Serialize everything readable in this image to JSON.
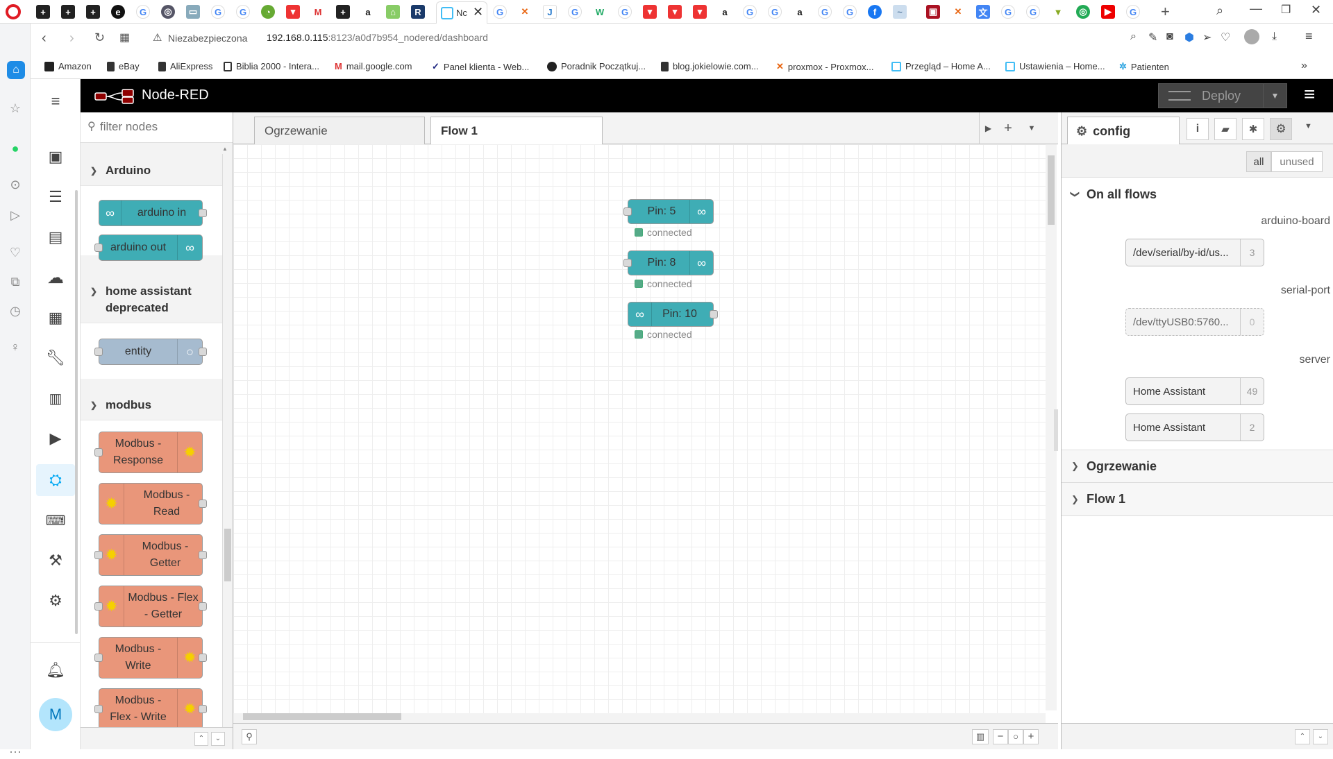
{
  "browser": {
    "address_warning": "Niezabezpieczona",
    "url_host": "192.168.0.115",
    "url_rest": ":8123/a0d7b954_nodered/dashboard",
    "active_tab_label": "Nc",
    "bookmarks": [
      {
        "label": "Amazon",
        "color": "#222"
      },
      {
        "label": "eBay",
        "color": "#333"
      },
      {
        "label": "AliExpress",
        "color": "#333"
      },
      {
        "label": "Biblia 2000 - Intera...",
        "color": "#333"
      },
      {
        "label": "mail.google.com",
        "color": "#d33"
      },
      {
        "label": "Panel klienta - Web...",
        "color": "#1a237e"
      },
      {
        "label": "Poradnik Początkuj...",
        "color": "#333"
      },
      {
        "label": "blog.jokielowie.com...",
        "color": "#333"
      },
      {
        "label": "proxmox - Proxmox...",
        "color": "#e8620c"
      },
      {
        "label": "Przegląd – Home A...",
        "color": "#41bdf5"
      },
      {
        "label": "Ustawienia – Home...",
        "color": "#41bdf5"
      },
      {
        "label": "Patienten",
        "color": "#2aa3e0"
      }
    ]
  },
  "ha_sidebar": {
    "avatar_initial": "M"
  },
  "nodered": {
    "title": "Node-RED",
    "deploy_label": "Deploy",
    "filter_placeholder": "filter nodes",
    "palette": {
      "categories": [
        {
          "name": "Arduino",
          "nodes": [
            "arduino in",
            "arduino out"
          ]
        },
        {
          "name": "home assistant deprecated",
          "nodes": [
            "entity"
          ]
        },
        {
          "name": "modbus",
          "nodes": [
            "Modbus - Response",
            "Modbus - Read",
            "Modbus - Getter",
            "Modbus - Flex - Getter",
            "Modbus - Write",
            "Modbus - Flex - Write"
          ]
        }
      ]
    },
    "tabs": [
      "Ogrzewanie",
      "Flow 1"
    ],
    "active_tab": "Flow 1",
    "flow_nodes": [
      {
        "label": "Pin: 5",
        "status": "connected"
      },
      {
        "label": "Pin: 8",
        "status": "connected"
      },
      {
        "label": "Pin: 10",
        "status": "connected"
      }
    ],
    "sidebar": {
      "tab_label": "config",
      "filter_all": "all",
      "filter_unused": "unused",
      "sections": {
        "on_all_flows": "On all flows",
        "ogrzewanie": "Ogrzewanie",
        "flow1": "Flow 1"
      },
      "groups": [
        {
          "type": "arduino-board",
          "nodes": [
            {
              "label": "/dev/serial/by-id/us...",
              "count": "3"
            }
          ]
        },
        {
          "type": "serial-port",
          "nodes": [
            {
              "label": "/dev/ttyUSB0:5760...",
              "count": "0"
            }
          ]
        },
        {
          "type": "server",
          "nodes": [
            {
              "label": "Home Assistant",
              "count": "49"
            },
            {
              "label": "Home Assistant",
              "count": "2"
            }
          ]
        }
      ]
    }
  },
  "colors": {
    "nr_header": "#000000",
    "arduino_node": "#3fadb5",
    "modbus_node": "#e9967a",
    "entity_node": "#a6bbcf",
    "ha_accent": "#03a9f4"
  }
}
